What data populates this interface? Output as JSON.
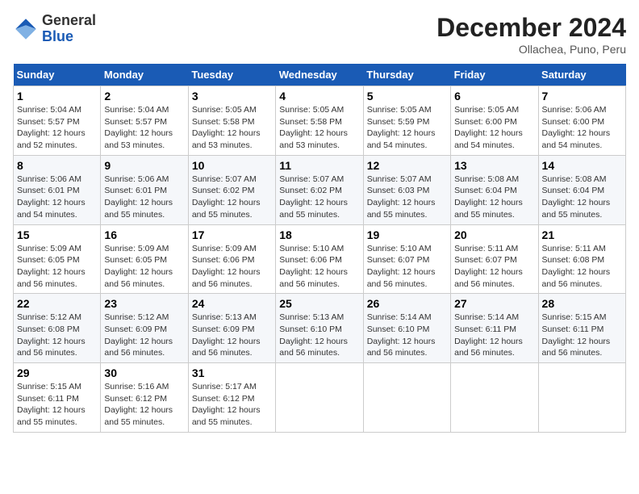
{
  "header": {
    "logo_general": "General",
    "logo_blue": "Blue",
    "month_title": "December 2024",
    "location": "Ollachea, Puno, Peru"
  },
  "days_of_week": [
    "Sunday",
    "Monday",
    "Tuesday",
    "Wednesday",
    "Thursday",
    "Friday",
    "Saturday"
  ],
  "weeks": [
    [
      {
        "day": "1",
        "info": "Sunrise: 5:04 AM\nSunset: 5:57 PM\nDaylight: 12 hours\nand 52 minutes."
      },
      {
        "day": "2",
        "info": "Sunrise: 5:04 AM\nSunset: 5:57 PM\nDaylight: 12 hours\nand 53 minutes."
      },
      {
        "day": "3",
        "info": "Sunrise: 5:05 AM\nSunset: 5:58 PM\nDaylight: 12 hours\nand 53 minutes."
      },
      {
        "day": "4",
        "info": "Sunrise: 5:05 AM\nSunset: 5:58 PM\nDaylight: 12 hours\nand 53 minutes."
      },
      {
        "day": "5",
        "info": "Sunrise: 5:05 AM\nSunset: 5:59 PM\nDaylight: 12 hours\nand 54 minutes."
      },
      {
        "day": "6",
        "info": "Sunrise: 5:05 AM\nSunset: 6:00 PM\nDaylight: 12 hours\nand 54 minutes."
      },
      {
        "day": "7",
        "info": "Sunrise: 5:06 AM\nSunset: 6:00 PM\nDaylight: 12 hours\nand 54 minutes."
      }
    ],
    [
      {
        "day": "8",
        "info": "Sunrise: 5:06 AM\nSunset: 6:01 PM\nDaylight: 12 hours\nand 54 minutes."
      },
      {
        "day": "9",
        "info": "Sunrise: 5:06 AM\nSunset: 6:01 PM\nDaylight: 12 hours\nand 55 minutes."
      },
      {
        "day": "10",
        "info": "Sunrise: 5:07 AM\nSunset: 6:02 PM\nDaylight: 12 hours\nand 55 minutes."
      },
      {
        "day": "11",
        "info": "Sunrise: 5:07 AM\nSunset: 6:02 PM\nDaylight: 12 hours\nand 55 minutes."
      },
      {
        "day": "12",
        "info": "Sunrise: 5:07 AM\nSunset: 6:03 PM\nDaylight: 12 hours\nand 55 minutes."
      },
      {
        "day": "13",
        "info": "Sunrise: 5:08 AM\nSunset: 6:04 PM\nDaylight: 12 hours\nand 55 minutes."
      },
      {
        "day": "14",
        "info": "Sunrise: 5:08 AM\nSunset: 6:04 PM\nDaylight: 12 hours\nand 55 minutes."
      }
    ],
    [
      {
        "day": "15",
        "info": "Sunrise: 5:09 AM\nSunset: 6:05 PM\nDaylight: 12 hours\nand 56 minutes."
      },
      {
        "day": "16",
        "info": "Sunrise: 5:09 AM\nSunset: 6:05 PM\nDaylight: 12 hours\nand 56 minutes."
      },
      {
        "day": "17",
        "info": "Sunrise: 5:09 AM\nSunset: 6:06 PM\nDaylight: 12 hours\nand 56 minutes."
      },
      {
        "day": "18",
        "info": "Sunrise: 5:10 AM\nSunset: 6:06 PM\nDaylight: 12 hours\nand 56 minutes."
      },
      {
        "day": "19",
        "info": "Sunrise: 5:10 AM\nSunset: 6:07 PM\nDaylight: 12 hours\nand 56 minutes."
      },
      {
        "day": "20",
        "info": "Sunrise: 5:11 AM\nSunset: 6:07 PM\nDaylight: 12 hours\nand 56 minutes."
      },
      {
        "day": "21",
        "info": "Sunrise: 5:11 AM\nSunset: 6:08 PM\nDaylight: 12 hours\nand 56 minutes."
      }
    ],
    [
      {
        "day": "22",
        "info": "Sunrise: 5:12 AM\nSunset: 6:08 PM\nDaylight: 12 hours\nand 56 minutes."
      },
      {
        "day": "23",
        "info": "Sunrise: 5:12 AM\nSunset: 6:09 PM\nDaylight: 12 hours\nand 56 minutes."
      },
      {
        "day": "24",
        "info": "Sunrise: 5:13 AM\nSunset: 6:09 PM\nDaylight: 12 hours\nand 56 minutes."
      },
      {
        "day": "25",
        "info": "Sunrise: 5:13 AM\nSunset: 6:10 PM\nDaylight: 12 hours\nand 56 minutes."
      },
      {
        "day": "26",
        "info": "Sunrise: 5:14 AM\nSunset: 6:10 PM\nDaylight: 12 hours\nand 56 minutes."
      },
      {
        "day": "27",
        "info": "Sunrise: 5:14 AM\nSunset: 6:11 PM\nDaylight: 12 hours\nand 56 minutes."
      },
      {
        "day": "28",
        "info": "Sunrise: 5:15 AM\nSunset: 6:11 PM\nDaylight: 12 hours\nand 56 minutes."
      }
    ],
    [
      {
        "day": "29",
        "info": "Sunrise: 5:15 AM\nSunset: 6:11 PM\nDaylight: 12 hours\nand 55 minutes."
      },
      {
        "day": "30",
        "info": "Sunrise: 5:16 AM\nSunset: 6:12 PM\nDaylight: 12 hours\nand 55 minutes."
      },
      {
        "day": "31",
        "info": "Sunrise: 5:17 AM\nSunset: 6:12 PM\nDaylight: 12 hours\nand 55 minutes."
      },
      null,
      null,
      null,
      null
    ]
  ]
}
